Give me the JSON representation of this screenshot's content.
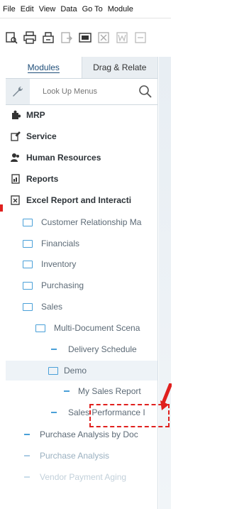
{
  "menubar": {
    "items": [
      "File",
      "Edit",
      "View",
      "Data",
      "Go To",
      "Module"
    ]
  },
  "toolbar": {
    "icons": [
      "preview-icon",
      "print-icon",
      "print-setup-icon",
      "export-icon",
      "publish-icon",
      "excel-icon",
      "word-icon",
      "pdf-icon"
    ]
  },
  "tabs": {
    "modules": "Modules",
    "drag_relate": "Drag & Relate"
  },
  "search": {
    "placeholder": "Look Up Menus"
  },
  "tree": {
    "mrp": "MRP",
    "service": "Service",
    "human_resources": "Human Resources",
    "reports": "Reports",
    "excel_report": "Excel Report and Interacti",
    "crm": "Customer Relationship Ma",
    "financials": "Financials",
    "inventory": "Inventory",
    "purchasing": "Purchasing",
    "sales": "Sales",
    "multi_doc": "Multi-Document Scena",
    "delivery_schedule": "Delivery Schedule",
    "demo": "Demo",
    "my_sales_report": "My Sales Report",
    "sales_performance": "Sales Performance I",
    "purchase_analysis_doc": "Purchase Analysis by Doc",
    "purchase_analysis": "Purchase Analysis",
    "vendor_payment_aging": "Vendor Payment Aging"
  },
  "colors": {
    "accent": "#4aa0d8",
    "annotation_red": "#e0201e"
  }
}
